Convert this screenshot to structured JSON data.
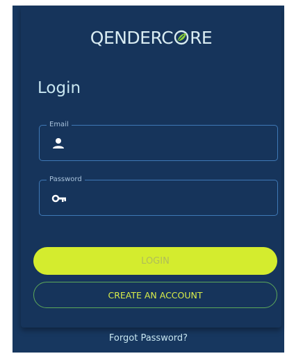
{
  "brand": {
    "prefix": "Q",
    "middle": "ENDERC",
    "suffix": "RE"
  },
  "login_title": "Login",
  "email_field": {
    "label": "Email",
    "value": "",
    "icon": "person-icon"
  },
  "password_field": {
    "label": "Password",
    "value": "",
    "icon": "key-icon"
  },
  "login_button": "LOGIN",
  "create_account_button": "CREATE AN ACCOUNT",
  "forgot_password_link": "Forgot Password?",
  "colors": {
    "background": "#17375f",
    "accent": "#d4ec2e",
    "field_border": "#3f79b6",
    "text": "#c8e6f0"
  }
}
